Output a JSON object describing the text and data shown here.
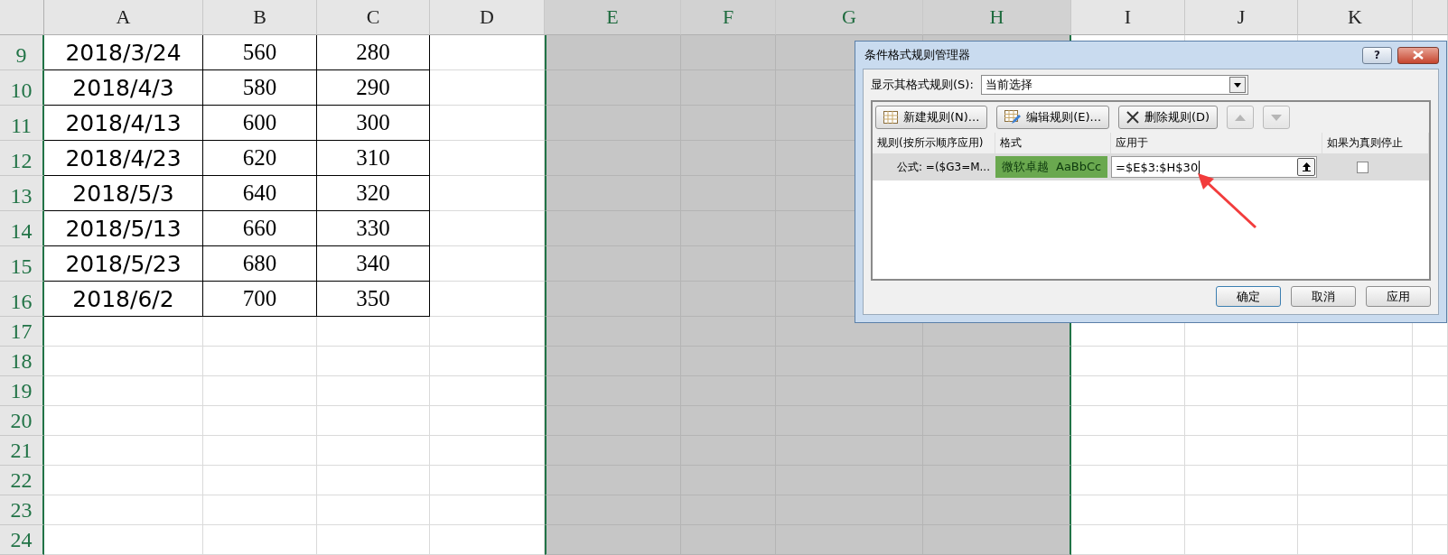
{
  "sheet": {
    "columns": [
      {
        "label": "A",
        "selected": false
      },
      {
        "label": "B",
        "selected": false
      },
      {
        "label": "C",
        "selected": false
      },
      {
        "label": "D",
        "selected": false
      },
      {
        "label": "E",
        "selected": true
      },
      {
        "label": "F",
        "selected": true
      },
      {
        "label": "G",
        "selected": true
      },
      {
        "label": "H",
        "selected": true
      },
      {
        "label": "I",
        "selected": false
      },
      {
        "label": "J",
        "selected": false
      },
      {
        "label": "K",
        "selected": false
      }
    ],
    "rows": [
      {
        "number": "9",
        "cells": [
          "2018/3/24",
          "560",
          "280"
        ]
      },
      {
        "number": "10",
        "cells": [
          "2018/4/3",
          "580",
          "290"
        ]
      },
      {
        "number": "11",
        "cells": [
          "2018/4/13",
          "600",
          "300"
        ]
      },
      {
        "number": "12",
        "cells": [
          "2018/4/23",
          "620",
          "310"
        ]
      },
      {
        "number": "13",
        "cells": [
          "2018/5/3",
          "640",
          "320"
        ]
      },
      {
        "number": "14",
        "cells": [
          "2018/5/13",
          "660",
          "330"
        ]
      },
      {
        "number": "15",
        "cells": [
          "2018/5/23",
          "680",
          "340"
        ]
      },
      {
        "number": "16",
        "cells": [
          "2018/6/2",
          "700",
          "350"
        ]
      },
      {
        "number": "17",
        "cells": []
      },
      {
        "number": "18",
        "cells": []
      },
      {
        "number": "19",
        "cells": []
      },
      {
        "number": "20",
        "cells": []
      },
      {
        "number": "21",
        "cells": []
      },
      {
        "number": "22",
        "cells": []
      },
      {
        "number": "23",
        "cells": []
      },
      {
        "number": "24",
        "cells": []
      }
    ]
  },
  "dialog": {
    "title": "条件格式规则管理器",
    "help": "?",
    "show_label": "显示其格式规则(S):",
    "show_value": "当前选择",
    "toolbar": [
      {
        "kind": "new",
        "label": "新建规则(N)..."
      },
      {
        "kind": "edit",
        "label": "编辑规则(E)..."
      },
      {
        "kind": "delete",
        "label": "删除规则(D)"
      },
      {
        "kind": "up",
        "disabled": true
      },
      {
        "kind": "down",
        "disabled": true
      }
    ],
    "columns": [
      "规则(按所示顺序应用)",
      "格式",
      "应用于",
      "如果为真则停止"
    ],
    "rules": [
      {
        "rule": "公式: =($G3=M...",
        "preview": "微软卓越  AaBbCc",
        "applies_to": "=$E$3:$H$30",
        "stop": false,
        "selected": true
      }
    ],
    "buttons": [
      {
        "label": "确定",
        "default": true
      },
      {
        "label": "取消",
        "default": false
      },
      {
        "label": "应用",
        "default": false
      }
    ]
  }
}
